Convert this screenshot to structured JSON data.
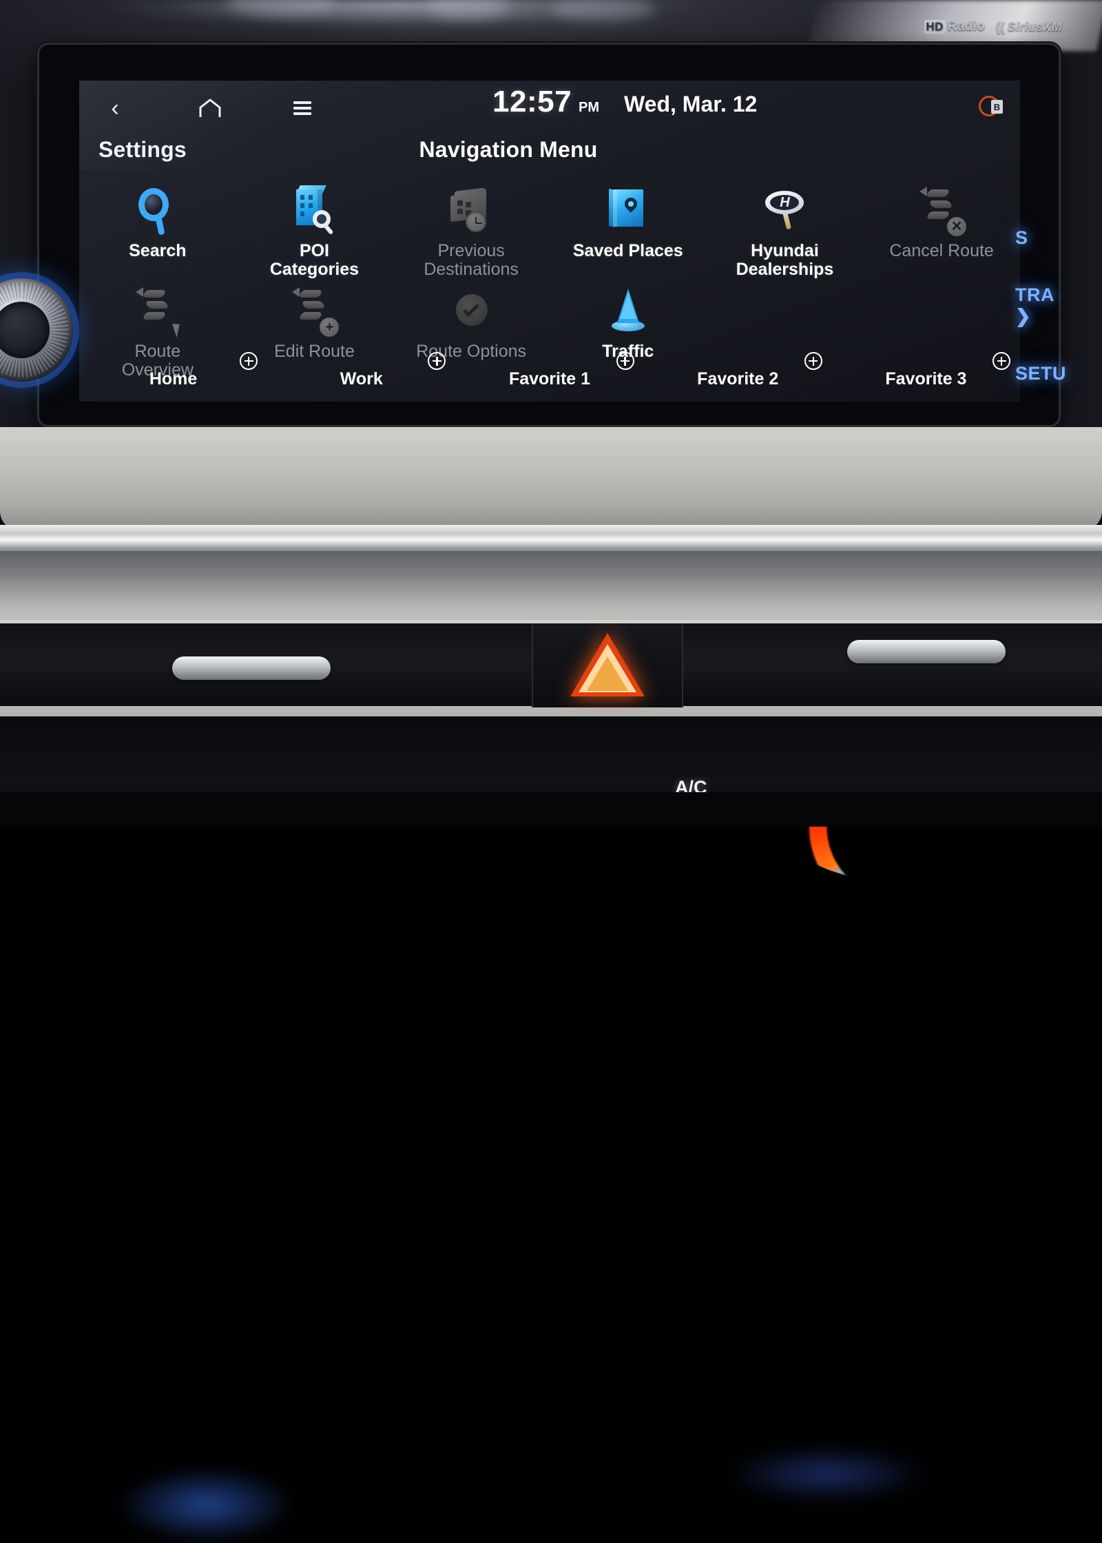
{
  "device": {
    "bezel_brands": [
      "HD Radio",
      "SiriusXM"
    ],
    "hd_mark": "HD",
    "hd_word": "Radio",
    "sirius_word": "SiriusXM"
  },
  "statusbar": {
    "back_icon": "chevron-left-icon",
    "home_icon": "home-icon",
    "menu_icon": "hamburger-menu-icon",
    "time": "12:57",
    "ampm": "PM",
    "date": "Wed, Mar. 12",
    "bt_badge_letter": "B"
  },
  "header": {
    "settings_label": "Settings",
    "title": "Navigation Menu"
  },
  "menu": {
    "row1": [
      {
        "label": "Search",
        "icon": "search-icon",
        "enabled": true
      },
      {
        "label": "POI\nCategories",
        "label_line1": "POI",
        "label_line2": "Categories",
        "icon": "poi-categories-icon",
        "enabled": true
      },
      {
        "label_line1": "Previous",
        "label_line2": "Destinations",
        "icon": "previous-destinations-icon",
        "enabled": false
      },
      {
        "label_line1": "Saved Places",
        "label_line2": "",
        "icon": "saved-places-icon",
        "enabled": true
      },
      {
        "label_line1": "Hyundai",
        "label_line2": "Dealerships",
        "icon": "hyundai-dealerships-icon",
        "enabled": true
      },
      {
        "label_line1": "Cancel Route",
        "label_line2": "",
        "icon": "cancel-route-icon",
        "enabled": false
      }
    ],
    "row2": [
      {
        "label_line1": "Route",
        "label_line2": "Overview",
        "icon": "route-overview-icon",
        "enabled": false
      },
      {
        "label_line1": "Edit Route",
        "label_line2": "",
        "icon": "edit-route-icon",
        "enabled": false
      },
      {
        "label_line1": "Route Options",
        "label_line2": "",
        "icon": "route-options-icon",
        "enabled": false
      },
      {
        "label_line1": "Traffic",
        "label_line2": "",
        "icon": "traffic-icon",
        "enabled": true
      }
    ]
  },
  "shortcuts": [
    {
      "label": "Home",
      "add_icon": "plus-circle-icon"
    },
    {
      "label": "Work",
      "add_icon": "plus-circle-icon"
    },
    {
      "label": "Favorite 1",
      "add_icon": "plus-circle-icon"
    },
    {
      "label": "Favorite 2",
      "add_icon": "plus-circle-icon"
    },
    {
      "label": "Favorite 3",
      "add_icon": "plus-circle-icon"
    }
  ],
  "hardware": {
    "volume_knob": "volume-knob",
    "right_buttons": [
      "S",
      "TRA",
      "SETU"
    ],
    "hazard_button": "hazard-lights-button",
    "ac_label": "A/C"
  },
  "colors": {
    "accent_blue": "#2ba9f0",
    "disabled_grey": "#8e919c",
    "button_backlight": "#7fb2ff",
    "hazard_red": "#e2420f"
  }
}
